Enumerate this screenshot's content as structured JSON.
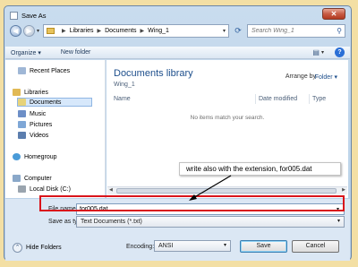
{
  "window": {
    "title": "Save As",
    "close_label": "✕"
  },
  "address": {
    "crumbs": [
      "Libraries",
      "Documents",
      "Wing_1"
    ]
  },
  "search": {
    "placeholder": "Search Wing_1"
  },
  "toolbar": {
    "organize": "Organize ▾",
    "new_folder": "New folder"
  },
  "sidebar": {
    "items": [
      {
        "label": "Recent Places"
      },
      {
        "label": "Libraries"
      },
      {
        "label": "Documents"
      },
      {
        "label": "Music"
      },
      {
        "label": "Pictures"
      },
      {
        "label": "Videos"
      },
      {
        "label": "Homegroup"
      },
      {
        "label": "Computer"
      },
      {
        "label": "Local Disk (C:)"
      }
    ]
  },
  "main": {
    "library_title": "Documents library",
    "library_sub": "Wing_1",
    "arrange_by_label": "Arrange by:",
    "arrange_by_value": "Folder ▾",
    "columns": [
      "Name",
      "Date modified",
      "Type"
    ],
    "empty_message": "No items match your search."
  },
  "form": {
    "file_name_label": "File name:",
    "file_name_value": "for005.dat",
    "save_as_type_label": "Save as type:",
    "save_as_type_value": "Text Documents (*.txt)",
    "encoding_label": "Encoding:",
    "encoding_value": "ANSI",
    "hide_folders": "Hide Folders",
    "save": "Save",
    "cancel": "Cancel"
  },
  "annotation": {
    "callout_text": "write also with the extension, for005.dat",
    "highlight_color": "#d9141b"
  }
}
